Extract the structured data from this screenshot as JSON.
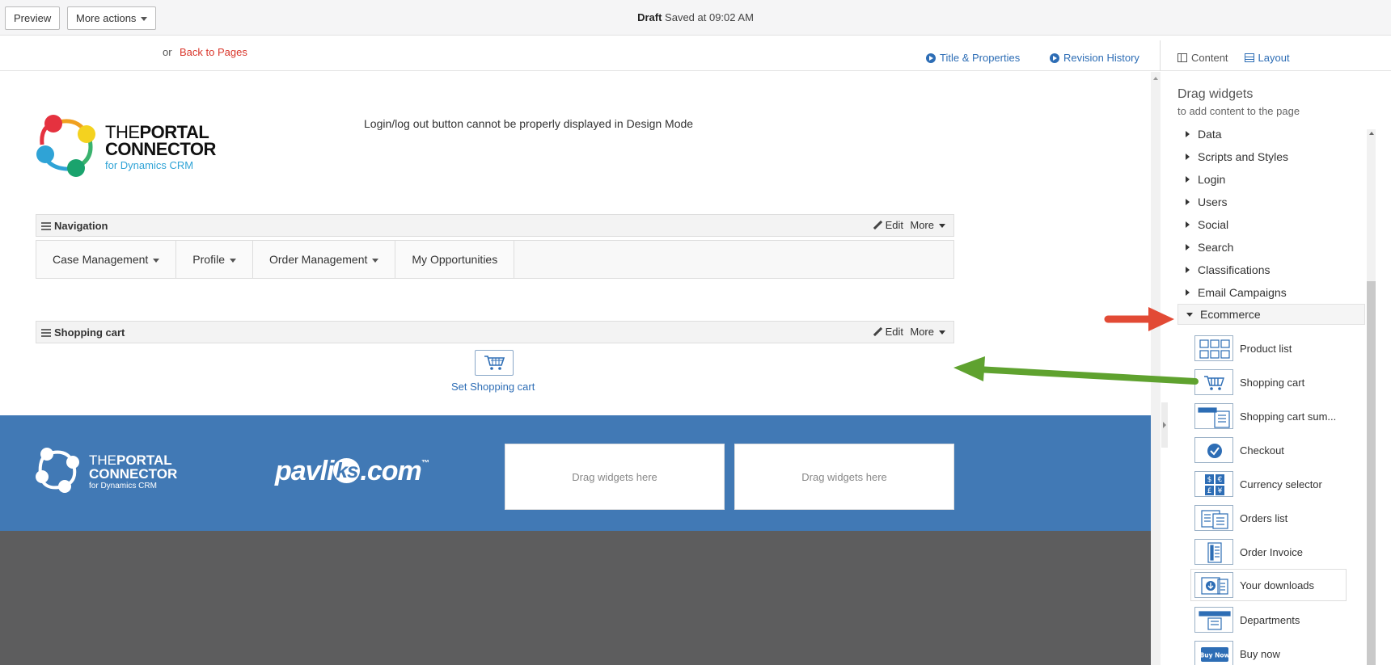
{
  "status": {
    "draft_label": "Draft",
    "saved_text": "Saved at 09:02 AM"
  },
  "toolbar": {
    "preview_label": "Preview",
    "more_actions_label": "More actions",
    "or_text": "or",
    "back_label": "Back to Pages",
    "title_properties_label": "Title & Properties",
    "revision_history_label": "Revision History",
    "tab_content_label": "Content",
    "tab_layout_label": "Layout"
  },
  "canvas": {
    "logo": {
      "line1_a": "THE",
      "line1_b": "PORTAL",
      "line2": "CONNECTOR",
      "line3": "for Dynamics CRM"
    },
    "login_message": "Login/log out button cannot be properly displayed in Design Mode",
    "navigation_widget": {
      "title": "Navigation",
      "edit_label": "Edit",
      "more_label": "More"
    },
    "nav_items": [
      {
        "label": "Case Management",
        "has_caret": true
      },
      {
        "label": "Profile",
        "has_caret": true
      },
      {
        "label": "Order Management",
        "has_caret": true
      },
      {
        "label": "My Opportunities",
        "has_caret": false
      }
    ],
    "cart_widget": {
      "title": "Shopping cart",
      "edit_label": "Edit",
      "more_label": "More",
      "set_label": "Set Shopping cart"
    }
  },
  "footer": {
    "logo": {
      "line1_a": "THE",
      "line1_b": "PORTAL",
      "line2": "CONNECTOR",
      "line3": "for Dynamics CRM"
    },
    "pavliks_a": "pavli",
    "pavliks_b": "ks",
    "pavliks_c": ".com",
    "pavliks_tm": "™",
    "drop_zone_1": "Drag widgets here",
    "drop_zone_2": "Drag widgets here"
  },
  "panel": {
    "title": "Drag widgets",
    "subtitle": "to add content to the page",
    "categories": [
      "Data",
      "Scripts and Styles",
      "Login",
      "Users",
      "Social",
      "Search",
      "Classifications",
      "Email Campaigns"
    ],
    "open_category": "Ecommerce",
    "widgets": [
      "Product list",
      "Shopping cart",
      "Shopping cart sum...",
      "Checkout",
      "Currency selector",
      "Orders list",
      "Order Invoice",
      "Your downloads",
      "Departments",
      "Buy now"
    ],
    "buy_now_icon_text": "Buy Now"
  },
  "colors": {
    "accent_blue": "#2d6db5",
    "footer_blue": "#4179b5",
    "back_link_red": "#d9362b",
    "red_arrow": "#e24a35",
    "green_arrow": "#5fa22f"
  }
}
